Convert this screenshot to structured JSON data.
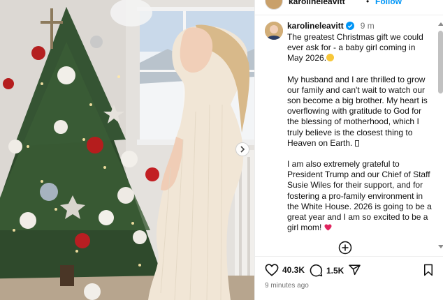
{
  "header": {
    "username": "karolineleavitt",
    "separator": "•",
    "follow_label": "Follow"
  },
  "caption": {
    "username": "karolineleavitt",
    "time": "9 m",
    "p1_l1": "The greatest Christmas gift we could",
    "p1_l2": "ever ask for - a baby girl coming in",
    "p1_l3": "May 2026.",
    "p2_l1": "My husband and I are thrilled to grow",
    "p2_l2": "our family and can't wait to watch our",
    "p2_l3": "son become a big brother. My heart is",
    "p2_l4": "overflowing with gratitude to God for",
    "p2_l5": "the blessing of motherhood, which I",
    "p2_l6": "truly believe is the closest thing to",
    "p2_l7": "Heaven on Earth.",
    "p3_l1": "I am also extremely grateful to",
    "p3_l2": "President Trump and our Chief of Staff",
    "p3_l3": "Susie Wiles for their support, and for",
    "p3_l4": "fostering a pro-family environment in",
    "p3_l5": "the White House. 2026 is going to be a",
    "p3_l6": "great year and I am so excited to be a",
    "p3_l7": "girl mom!"
  },
  "actions": {
    "likes": "40.3K",
    "comments": "1.5K"
  },
  "timestamp": "9 minutes ago",
  "icons": {
    "verified": "verified-badge-icon",
    "like": "heart-icon",
    "comment": "comment-bubble-icon",
    "share": "paper-plane-icon",
    "save": "bookmark-icon",
    "load_more": "plus-circle-icon",
    "carousel_next": "chevron-right-icon"
  },
  "colors": {
    "follow": "#0095f6",
    "verified": "#0095f6",
    "heart_emoji": "#e0245e",
    "muted": "#737373"
  }
}
